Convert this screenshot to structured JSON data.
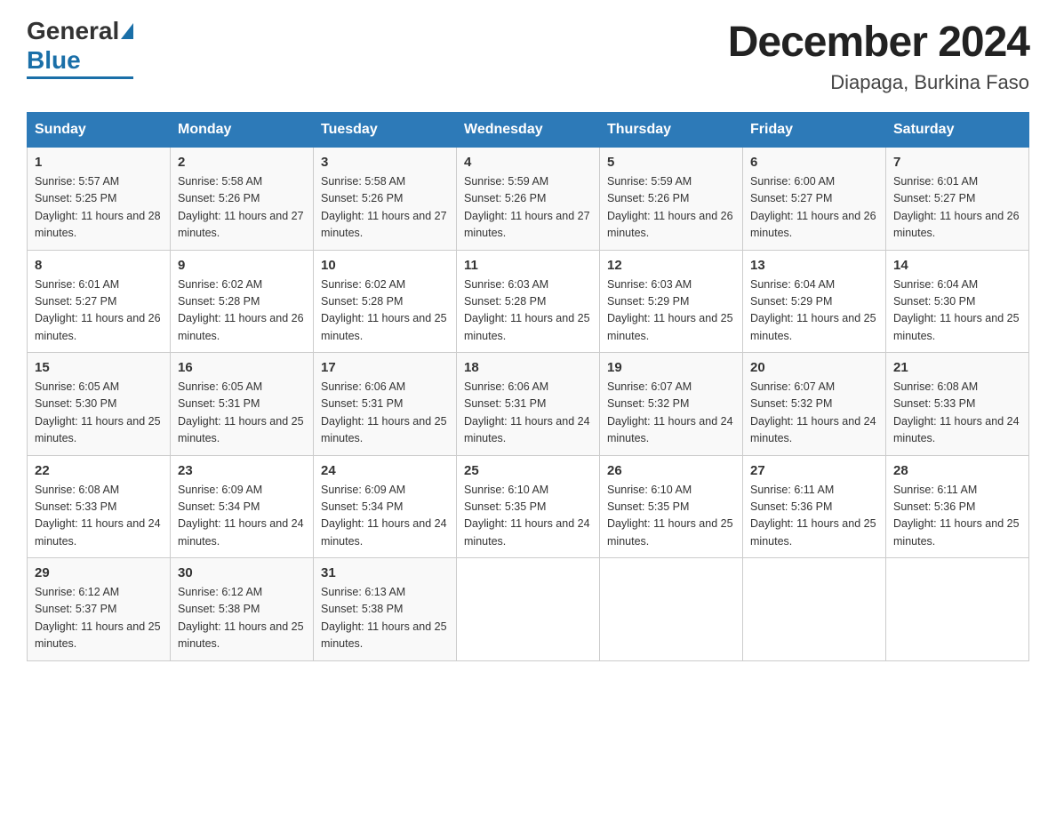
{
  "header": {
    "title": "December 2024",
    "subtitle": "Diapaga, Burkina Faso",
    "logo_general": "General",
    "logo_blue": "Blue"
  },
  "days_of_week": [
    "Sunday",
    "Monday",
    "Tuesday",
    "Wednesday",
    "Thursday",
    "Friday",
    "Saturday"
  ],
  "weeks": [
    [
      {
        "day": "1",
        "sunrise": "5:57 AM",
        "sunset": "5:25 PM",
        "daylight": "11 hours and 28 minutes."
      },
      {
        "day": "2",
        "sunrise": "5:58 AM",
        "sunset": "5:26 PM",
        "daylight": "11 hours and 27 minutes."
      },
      {
        "day": "3",
        "sunrise": "5:58 AM",
        "sunset": "5:26 PM",
        "daylight": "11 hours and 27 minutes."
      },
      {
        "day": "4",
        "sunrise": "5:59 AM",
        "sunset": "5:26 PM",
        "daylight": "11 hours and 27 minutes."
      },
      {
        "day": "5",
        "sunrise": "5:59 AM",
        "sunset": "5:26 PM",
        "daylight": "11 hours and 26 minutes."
      },
      {
        "day": "6",
        "sunrise": "6:00 AM",
        "sunset": "5:27 PM",
        "daylight": "11 hours and 26 minutes."
      },
      {
        "day": "7",
        "sunrise": "6:01 AM",
        "sunset": "5:27 PM",
        "daylight": "11 hours and 26 minutes."
      }
    ],
    [
      {
        "day": "8",
        "sunrise": "6:01 AM",
        "sunset": "5:27 PM",
        "daylight": "11 hours and 26 minutes."
      },
      {
        "day": "9",
        "sunrise": "6:02 AM",
        "sunset": "5:28 PM",
        "daylight": "11 hours and 26 minutes."
      },
      {
        "day": "10",
        "sunrise": "6:02 AM",
        "sunset": "5:28 PM",
        "daylight": "11 hours and 25 minutes."
      },
      {
        "day": "11",
        "sunrise": "6:03 AM",
        "sunset": "5:28 PM",
        "daylight": "11 hours and 25 minutes."
      },
      {
        "day": "12",
        "sunrise": "6:03 AM",
        "sunset": "5:29 PM",
        "daylight": "11 hours and 25 minutes."
      },
      {
        "day": "13",
        "sunrise": "6:04 AM",
        "sunset": "5:29 PM",
        "daylight": "11 hours and 25 minutes."
      },
      {
        "day": "14",
        "sunrise": "6:04 AM",
        "sunset": "5:30 PM",
        "daylight": "11 hours and 25 minutes."
      }
    ],
    [
      {
        "day": "15",
        "sunrise": "6:05 AM",
        "sunset": "5:30 PM",
        "daylight": "11 hours and 25 minutes."
      },
      {
        "day": "16",
        "sunrise": "6:05 AM",
        "sunset": "5:31 PM",
        "daylight": "11 hours and 25 minutes."
      },
      {
        "day": "17",
        "sunrise": "6:06 AM",
        "sunset": "5:31 PM",
        "daylight": "11 hours and 25 minutes."
      },
      {
        "day": "18",
        "sunrise": "6:06 AM",
        "sunset": "5:31 PM",
        "daylight": "11 hours and 24 minutes."
      },
      {
        "day": "19",
        "sunrise": "6:07 AM",
        "sunset": "5:32 PM",
        "daylight": "11 hours and 24 minutes."
      },
      {
        "day": "20",
        "sunrise": "6:07 AM",
        "sunset": "5:32 PM",
        "daylight": "11 hours and 24 minutes."
      },
      {
        "day": "21",
        "sunrise": "6:08 AM",
        "sunset": "5:33 PM",
        "daylight": "11 hours and 24 minutes."
      }
    ],
    [
      {
        "day": "22",
        "sunrise": "6:08 AM",
        "sunset": "5:33 PM",
        "daylight": "11 hours and 24 minutes."
      },
      {
        "day": "23",
        "sunrise": "6:09 AM",
        "sunset": "5:34 PM",
        "daylight": "11 hours and 24 minutes."
      },
      {
        "day": "24",
        "sunrise": "6:09 AM",
        "sunset": "5:34 PM",
        "daylight": "11 hours and 24 minutes."
      },
      {
        "day": "25",
        "sunrise": "6:10 AM",
        "sunset": "5:35 PM",
        "daylight": "11 hours and 24 minutes."
      },
      {
        "day": "26",
        "sunrise": "6:10 AM",
        "sunset": "5:35 PM",
        "daylight": "11 hours and 25 minutes."
      },
      {
        "day": "27",
        "sunrise": "6:11 AM",
        "sunset": "5:36 PM",
        "daylight": "11 hours and 25 minutes."
      },
      {
        "day": "28",
        "sunrise": "6:11 AM",
        "sunset": "5:36 PM",
        "daylight": "11 hours and 25 minutes."
      }
    ],
    [
      {
        "day": "29",
        "sunrise": "6:12 AM",
        "sunset": "5:37 PM",
        "daylight": "11 hours and 25 minutes."
      },
      {
        "day": "30",
        "sunrise": "6:12 AM",
        "sunset": "5:38 PM",
        "daylight": "11 hours and 25 minutes."
      },
      {
        "day": "31",
        "sunrise": "6:13 AM",
        "sunset": "5:38 PM",
        "daylight": "11 hours and 25 minutes."
      },
      null,
      null,
      null,
      null
    ]
  ]
}
